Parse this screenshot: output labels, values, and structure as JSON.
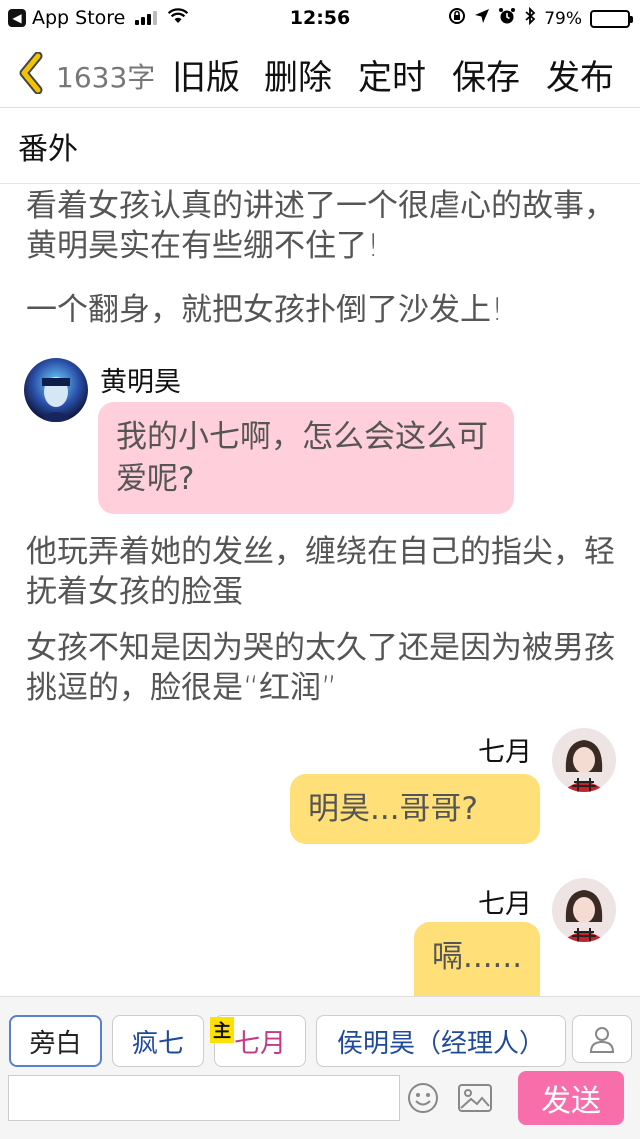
{
  "status_bar": {
    "back_app": "App Store",
    "time": "12:56",
    "battery": "79%",
    "battery_level": 0.79
  },
  "toolbar": {
    "char_count": "1633字",
    "old_version": "旧版",
    "delete": "删除",
    "schedule": "定时",
    "save": "保存",
    "publish": "发布"
  },
  "chapter": {
    "title": "番外"
  },
  "story": {
    "para1": "看着女孩认真的讲述了一个很虐心的故事，黄明昊实在有些绷不住了!",
    "para2": "一个翻身，就把女孩扑倒了沙发上!",
    "msg1": {
      "speaker": "黄明昊",
      "text": "我的小七啊，怎么会这么可爱呢?"
    },
    "para3": "他玩弄着她的发丝，缠绕在自己的指尖，轻抚着女孩的脸蛋",
    "para4": "女孩不知是因为哭的太久了还是因为被男孩挑逗的，脸很是“红润”",
    "msg2": {
      "speaker": "七月",
      "text": "明昊...哥哥?"
    },
    "msg3": {
      "speaker": "七月",
      "text": "嗝......"
    }
  },
  "roles": {
    "narrator": "旁白",
    "role1": "疯七",
    "main_tag": "主",
    "role2": "七月",
    "role3": "侯明昊（经理人）"
  },
  "input": {
    "placeholder": "",
    "send": "发送"
  },
  "colors": {
    "pink_bubble": "#ffd0dc",
    "yellow_bubble": "#ffdf77",
    "send_button": "#f86eaa",
    "back_arrow": "#f0c400"
  }
}
